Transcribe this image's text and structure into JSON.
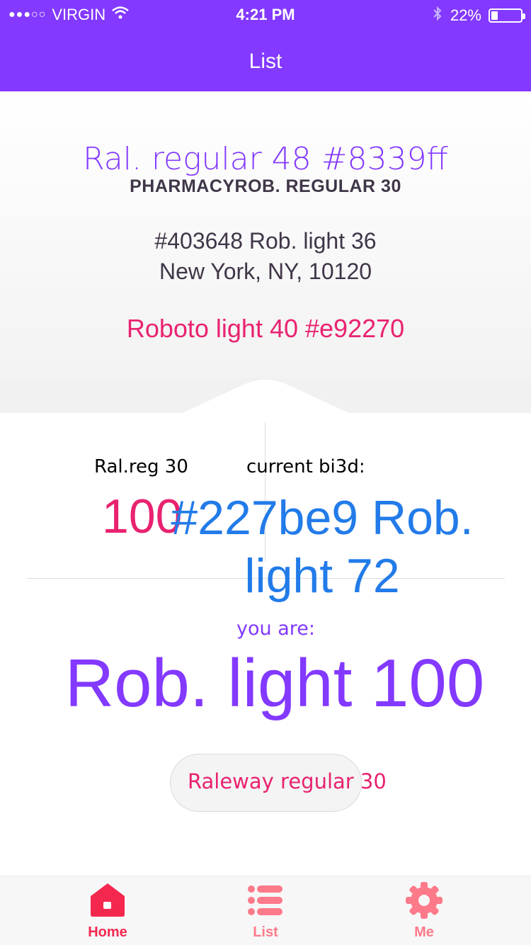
{
  "colors": {
    "accent": "#8339ff",
    "pink": "#e92270",
    "blue": "#227be9",
    "text": "#403648"
  },
  "status": {
    "carrier": "VIRGIN",
    "signal": "●●●○○",
    "time": "4:21 PM",
    "battery": "22%",
    "battery_level": 0.22
  },
  "nav": {
    "title": "List"
  },
  "header": {
    "pharmacy": "Ral. regular 48 #8339ff",
    "subtitle": "PHARMACYROB. REGULAR 30",
    "address_line1": "#403648 Rob. light 36",
    "address_line2": "New York, NY, 10120",
    "accent_line": "Roboto light 40 #e92270"
  },
  "auction": {
    "left_label": "Ral.reg 30",
    "right_label": "current bi3d:",
    "count": "100",
    "bid": "#227be9 Rob. light 72",
    "you_are_label": "you are:",
    "you_are_value": "Rob. light 100",
    "button_label": "Raleway regular 30"
  },
  "tabs": [
    {
      "label": "Home",
      "icon": "home-icon",
      "color": "#f4284e"
    },
    {
      "label": "List",
      "icon": "list-icon",
      "color": "#fd7a8a"
    },
    {
      "label": "Me",
      "icon": "gear-icon",
      "color": "#fd7a8a"
    }
  ]
}
